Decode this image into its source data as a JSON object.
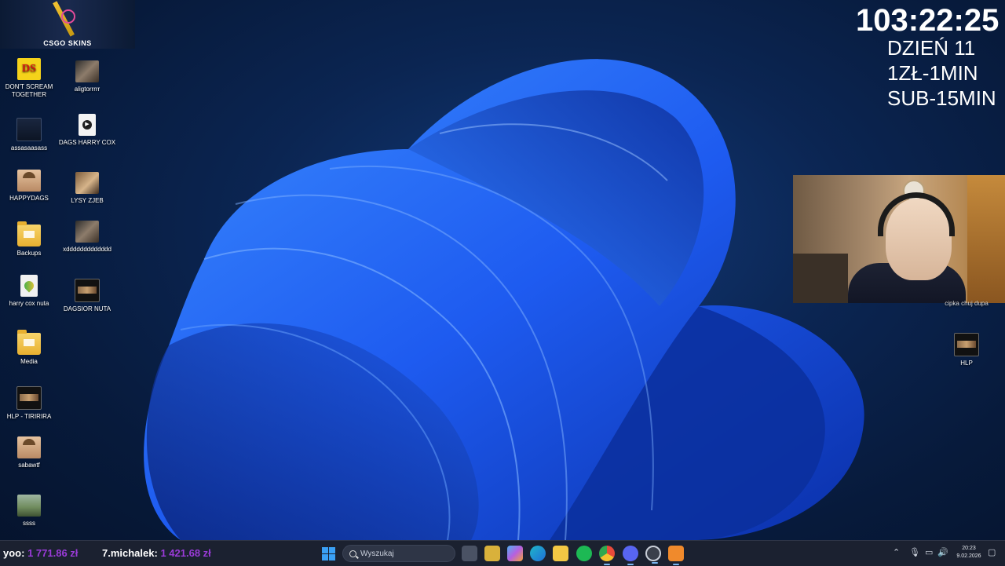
{
  "banner": {
    "name": "CSGO SKINS"
  },
  "overlay": {
    "timer": "103:22:25",
    "day": "DZIEŃ 11",
    "rate_money": "1ZŁ-1MIN",
    "rate_sub": "SUB-15MIN"
  },
  "desktop_icons": [
    {
      "label": "DON'T SCREAM TOGETHER",
      "icon": "game-icon"
    },
    {
      "label": "aligtorrrrr",
      "icon": "photo-icon"
    },
    {
      "label": "assasaasass",
      "icon": "image-icon"
    },
    {
      "label": "DAGS HARRY COX",
      "icon": "media-file-icon"
    },
    {
      "label": "HAPPYDAGS",
      "icon": "photo-icon"
    },
    {
      "label": "LYSY ZJEB",
      "icon": "photo-icon"
    },
    {
      "label": "Backups",
      "icon": "folder-icon"
    },
    {
      "label": "xddddddddddddd",
      "icon": "photo-icon"
    },
    {
      "label": "harry cox nuta",
      "icon": "audio-file-icon"
    },
    {
      "label": "DAGSIOR NUTA",
      "icon": "video-icon"
    },
    {
      "label": "Media",
      "icon": "folder-icon"
    },
    {
      "label": "HLP - TIRIRIRA",
      "icon": "video-icon"
    },
    {
      "label": "sabawtf",
      "icon": "photo-icon"
    },
    {
      "label": "ssss",
      "icon": "image-icon"
    },
    {
      "label": "HLP",
      "icon": "video-icon"
    }
  ],
  "webcam": {
    "caption": "cipka chuj dupa"
  },
  "taskbar": {
    "donations": [
      {
        "name": "yoo:",
        "amount": "1 771.86 zł"
      },
      {
        "name": "7.michalek:",
        "amount": "1 421.68 zł"
      }
    ],
    "search_placeholder": "Wyszukaj",
    "apps": [
      {
        "name": "task-view",
        "color": "#9aa3b5"
      },
      {
        "name": "store",
        "color": "#d9b13b"
      },
      {
        "name": "copilot",
        "color": "#b65fe0"
      },
      {
        "name": "edge",
        "color": "#1f9bd9"
      },
      {
        "name": "file-explorer",
        "color": "#f2c744"
      },
      {
        "name": "spotify",
        "color": "#1db954"
      },
      {
        "name": "chrome",
        "color": "#e84a3b"
      },
      {
        "name": "discord",
        "color": "#5865f2"
      },
      {
        "name": "steam-like",
        "color": "#c9ced8"
      },
      {
        "name": "orange-app",
        "color": "#f08a2c"
      }
    ],
    "time": "20:23",
    "date": "9.02.2026"
  }
}
